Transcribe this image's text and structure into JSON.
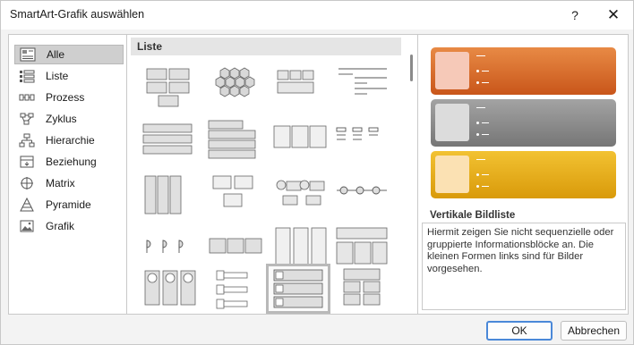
{
  "window": {
    "title": "SmartArt-Grafik auswählen",
    "help": "?",
    "close": "✕"
  },
  "categories": [
    {
      "label": "Alle",
      "icon": "all-icon",
      "selected": true
    },
    {
      "label": "Liste",
      "icon": "list-icon"
    },
    {
      "label": "Prozess",
      "icon": "process-icon"
    },
    {
      "label": "Zyklus",
      "icon": "cycle-icon"
    },
    {
      "label": "Hierarchie",
      "icon": "hierarchy-icon"
    },
    {
      "label": "Beziehung",
      "icon": "relationship-icon"
    },
    {
      "label": "Matrix",
      "icon": "matrix-icon"
    },
    {
      "label": "Pyramide",
      "icon": "pyramid-icon"
    },
    {
      "label": "Grafik",
      "icon": "picture-icon"
    }
  ],
  "gallery": {
    "section_title": "Liste",
    "selected_index": 18
  },
  "preview": {
    "colors": [
      "#e8732c",
      "#8d8d8d",
      "#e8b21a"
    ],
    "pic_colors": [
      "#f6c9b8",
      "#dcdcdc",
      "#fbe1b3"
    ]
  },
  "details": {
    "layout_name": "Vertikale Bildliste",
    "description": "Hiermit zeigen Sie nicht sequenzielle oder gruppierte Informationsblöcke an. Die kleinen Formen links sind für Bilder vorgesehen."
  },
  "buttons": {
    "ok": "OK",
    "cancel": "Abbrechen"
  }
}
